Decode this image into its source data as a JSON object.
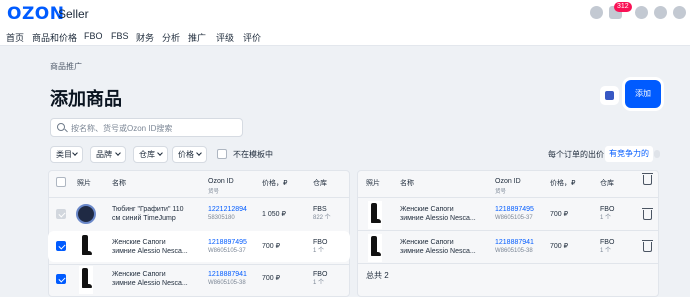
{
  "header": {
    "logo": "OZON",
    "logo_sub": "Seller",
    "notification_count": "312",
    "icons": [
      "crown-icon",
      "chat-icon",
      "help-icon",
      "education-icon",
      "settings-icon"
    ]
  },
  "nav": [
    "首页",
    "商品和价格",
    "FBO",
    "FBS",
    "财务",
    "分析",
    "推广",
    "评级",
    "评价"
  ],
  "breadcrumb": "商品推广",
  "title": "添加商品",
  "add_button": "添加",
  "search_placeholder": "按名称、货号或Ozon ID搜索",
  "filters": [
    "类目",
    "品牌",
    "仓库",
    "价格"
  ],
  "not_in_template_label": "不在模板中",
  "price_per_order_label": "每个订单的出价",
  "price_competitive_link": "有竞争力的",
  "left_table": {
    "headers": {
      "photo": "照片",
      "name": "名称",
      "ozon_id": "Ozon ID",
      "ozon_id_sub": "货号",
      "price": "价格，₽",
      "warehouse": "仓库"
    },
    "rows": [
      {
        "thumb": "watch",
        "name1": "Тюбинг \"Графити\" 110",
        "name2": "см синий TimeJump",
        "id": "1221212894",
        "sku": "58305180",
        "price": "1 050 ₽",
        "wh": "FBS",
        "qty": "822 个",
        "check": "grey"
      },
      {
        "thumb": "boot",
        "name1": "Женские Сапоги",
        "name2": "зимние Alessio Nesca...",
        "id": "1218897495",
        "sku": "W8605105-37",
        "price": "700 ₽",
        "wh": "FBO",
        "qty": "1 个",
        "check": "checked"
      },
      {
        "thumb": "boot",
        "name1": "Женские Сапоги",
        "name2": "зимние Alessio Nesca...",
        "id": "1218887941",
        "sku": "W8605105-38",
        "price": "700 ₽",
        "wh": "FBO",
        "qty": "1 个",
        "check": "checked"
      }
    ]
  },
  "right_table": {
    "headers": {
      "photo": "照片",
      "name": "名称",
      "ozon_id": "Ozon ID",
      "ozon_id_sub": "货号",
      "price": "价格，₽",
      "warehouse": "仓库"
    },
    "rows": [
      {
        "name1": "Женские Сапоги",
        "name2": "зимние Alessio Nesca...",
        "id": "1218897495",
        "sku": "W8605105-37",
        "price": "700 ₽",
        "wh": "FBO",
        "qty": "1 个"
      },
      {
        "name1": "Женские Сапоги",
        "name2": "зимние Alessio Nesca...",
        "id": "1218887941",
        "sku": "W8605105-38",
        "price": "700 ₽",
        "wh": "FBO",
        "qty": "1 个"
      }
    ],
    "total": "总共 2"
  }
}
